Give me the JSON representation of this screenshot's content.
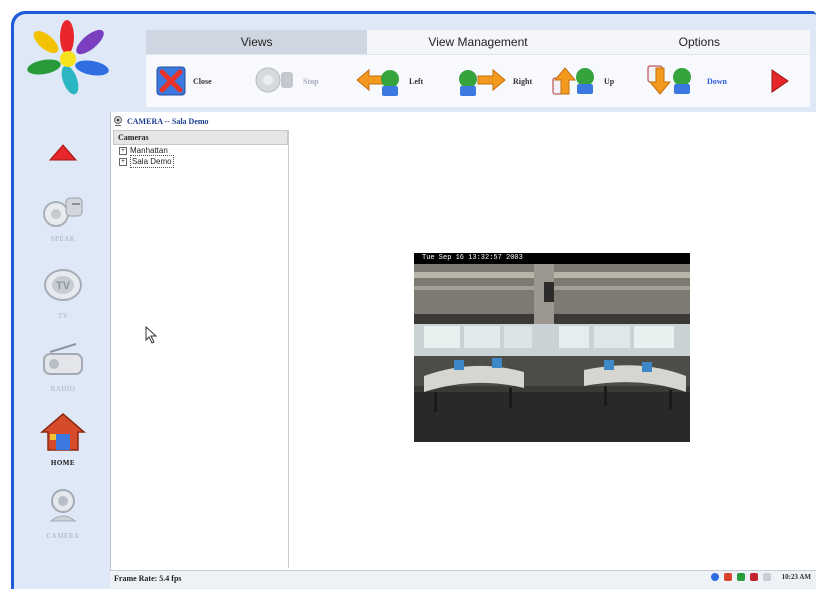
{
  "tabs": [
    {
      "label": "Views",
      "active": true
    },
    {
      "label": "View Management",
      "active": false
    },
    {
      "label": "Options",
      "active": false
    }
  ],
  "toolbar": {
    "close_label": "Close",
    "stop_label": "Stop",
    "left_label": "Left",
    "right_label": "Right",
    "up_label": "Up",
    "down_label": "Down"
  },
  "nav": {
    "speak_label": "SPEAK",
    "tv_label": "TV",
    "radio_label": "RADIO",
    "home_label": "HOME",
    "camera_label": "CAMERA"
  },
  "panel": {
    "title": "CAMERA -- Sala Demo",
    "cameras_header": "Cameras",
    "cameras": [
      "Manhattan",
      "Sala Demo"
    ],
    "selected_camera": "Sala Demo"
  },
  "video": {
    "timestamp": "Tue Sep 16 13:32:57 2003"
  },
  "status": {
    "frame_rate": "Frame Rate: 5.4 fps",
    "clock": "10:23 AM"
  },
  "colors": {
    "frame_blue": "#1f5bd6",
    "panel_bg": "#dfe8f6",
    "title_blue": "#1d3f8f",
    "down_blue": "#2a5ed8"
  }
}
